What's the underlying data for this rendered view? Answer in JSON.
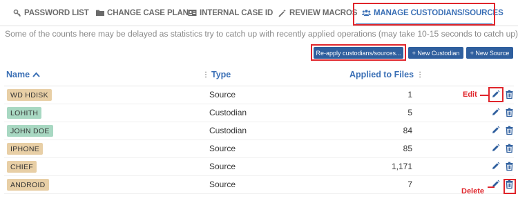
{
  "tabs": [
    {
      "label": "PASSWORD LIST",
      "icon": "key-icon"
    },
    {
      "label": "CHANGE CASE PLAN",
      "icon": "folder-icon"
    },
    {
      "label": "INTERNAL CASE ID",
      "icon": "id-card-icon"
    },
    {
      "label": "REVIEW MACROS",
      "icon": "magic-wand-icon"
    },
    {
      "label": "MANAGE CUSTODIANS/SOURCES",
      "icon": "users-icon",
      "active": true
    }
  ],
  "notice": "Some of the counts here may be delayed as statistics try to catch up with recently applied operations (may take 10-15 seconds to catch up).",
  "buttons": {
    "reapply": "Re-apply custodians/sources...",
    "new_custodian": "+ New Custodian",
    "new_source": "+ New Source"
  },
  "table": {
    "headers": {
      "name": "Name",
      "type": "Type",
      "applied": "Applied to Files"
    },
    "rows": [
      {
        "name": "WD HDISK",
        "type": "Source",
        "applied": "1"
      },
      {
        "name": "LOHITH",
        "type": "Custodian",
        "applied": "5"
      },
      {
        "name": "JOHN DOE",
        "type": "Custodian",
        "applied": "84"
      },
      {
        "name": "IPHONE",
        "type": "Source",
        "applied": "85"
      },
      {
        "name": "CHIEF",
        "type": "Source",
        "applied": "1,171"
      },
      {
        "name": "ANDROID",
        "type": "Source",
        "applied": "7"
      }
    ]
  },
  "annotations": {
    "edit": "Edit",
    "delete": "Delete"
  },
  "colors": {
    "accent": "#3a6fb5",
    "button": "#2f5f9e",
    "source_badge": "#e8cfa6",
    "custodian_badge": "#a8d8c2",
    "annotation": "#e0252b",
    "delete_icon": "#2f5f9e"
  }
}
